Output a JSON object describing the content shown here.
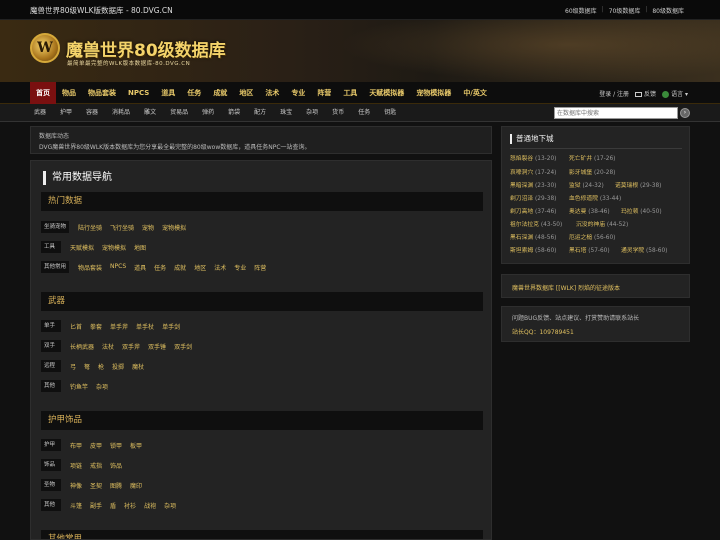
{
  "topbar": {
    "site_title": "魔兽世界80级WLK版数据库 - 80.DVG.CN",
    "links": [
      "60级数据库",
      "70级数据库",
      "80级数据库"
    ]
  },
  "banner": {
    "emblem_letter": "W",
    "title": "魔兽世界80级数据库",
    "subtitle": "最简单最完整的WLK版本数据库-80.DVG.CN"
  },
  "mainnav": {
    "items": [
      "首页",
      "物品",
      "物品套装",
      "NPCS",
      "道具",
      "任务",
      "成就",
      "地区",
      "法术",
      "专业",
      "阵营",
      "工具",
      "天赋模拟器",
      "宠物模拟器",
      "中/英文"
    ],
    "active": "首页",
    "login": "登录 / 注册",
    "feedback": "反馈",
    "language": "语言"
  },
  "subnav": {
    "items": [
      "武器",
      "护甲",
      "容器",
      "消耗品",
      "雕文",
      "贸易品",
      "弹药",
      "箭袋",
      "配方",
      "珠宝",
      "杂项",
      "货币",
      "任务",
      "钥匙"
    ],
    "search_placeholder": "在数据库中搜索"
  },
  "news": {
    "heading": "数据库动态",
    "text": "DVG魔兽世界80级WLK版本数据库为您分享最全最完整的80级wow数据库，道具任务NPC一站查询。"
  },
  "main": {
    "title": "常用数据导航",
    "sections": [
      {
        "name": "热门数据",
        "rows": [
          {
            "label": "坐骑宠物",
            "items": [
              "陆行坐骑",
              "飞行坐骑",
              "宠物",
              "宠物模拟"
            ]
          },
          {
            "label": "工具",
            "items": [
              "天赋模拟",
              "宠物模拟",
              "地图"
            ]
          },
          {
            "label": "其他常用",
            "items": [
              "物品套装",
              "NPCS",
              "道具",
              "任务",
              "成就",
              "地区",
              "法术",
              "专业",
              "阵营"
            ]
          }
        ]
      },
      {
        "name": "武器",
        "rows": [
          {
            "label": "单手",
            "items": [
              "匕首",
              "拳套",
              "单手斧",
              "单手杖",
              "单手剑"
            ]
          },
          {
            "label": "双手",
            "items": [
              "长柄武器",
              "法杖",
              "双手斧",
              "双手锤",
              "双手剑"
            ]
          },
          {
            "label": "远程",
            "items": [
              "弓",
              "弩",
              "枪",
              "投掷",
              "魔杖"
            ]
          },
          {
            "label": "其他",
            "items": [
              "钓鱼竿",
              "杂项"
            ]
          }
        ]
      },
      {
        "name": "护甲饰品",
        "rows": [
          {
            "label": "护甲",
            "items": [
              "布甲",
              "皮甲",
              "锁甲",
              "板甲"
            ]
          },
          {
            "label": "饰品",
            "items": [
              "项链",
              "戒指",
              "饰品"
            ]
          },
          {
            "label": "圣物",
            "items": [
              "神像",
              "圣契",
              "图腾",
              "魔印"
            ]
          },
          {
            "label": "其他",
            "items": [
              "斗篷",
              "副手",
              "盾",
              "衬衫",
              "战袍",
              "杂项"
            ]
          }
        ]
      },
      {
        "name": "其他常用",
        "rows": []
      }
    ]
  },
  "sidebar": {
    "dungeon_title": "普通地下城",
    "dungeons": [
      {
        "name": "怒焰裂谷",
        "level": "(13-20)"
      },
      {
        "name": "死亡矿井",
        "level": "(17-26)"
      },
      {
        "name": "哀嚎洞穴",
        "level": "(17-24)"
      },
      {
        "name": "影牙城堡",
        "level": "(20-28)"
      },
      {
        "name": "黑暗深渊",
        "level": "(23-30)"
      },
      {
        "name": "监狱",
        "level": "(24-32)"
      },
      {
        "name": "诺莫瑞根",
        "level": "(29-38)"
      },
      {
        "name": "剃刀沼泽",
        "level": "(29-38)"
      },
      {
        "name": "血色修道院",
        "level": "(33-44)"
      },
      {
        "name": "剃刀高地",
        "level": "(37-46)"
      },
      {
        "name": "奥达曼",
        "level": "(38-46)"
      },
      {
        "name": "玛拉顿",
        "level": "(40-50)"
      },
      {
        "name": "祖尔法拉克",
        "level": "(43-50)"
      },
      {
        "name": "沉没的神庙",
        "level": "(44-52)"
      },
      {
        "name": "黑石深渊",
        "level": "(48-56)"
      },
      {
        "name": "厄运之槌",
        "level": "(56-60)"
      },
      {
        "name": "斯坦索姆",
        "level": "(58-60)"
      },
      {
        "name": "黑石塔",
        "level": "(57-60)"
      },
      {
        "name": "通灵学院",
        "level": "(58-60)"
      }
    ],
    "promo": "魔兽世界数据库 [[WLK] 烈焰的征途版本",
    "contact_line": "问题BUG反馈、站点建议、打赏赞助请联系站长",
    "contact_qq": "站长QQ：109789451"
  },
  "colors": {
    "accent_gold": "#e0c060",
    "active_tab": "#7a1010",
    "background": "#111111"
  }
}
